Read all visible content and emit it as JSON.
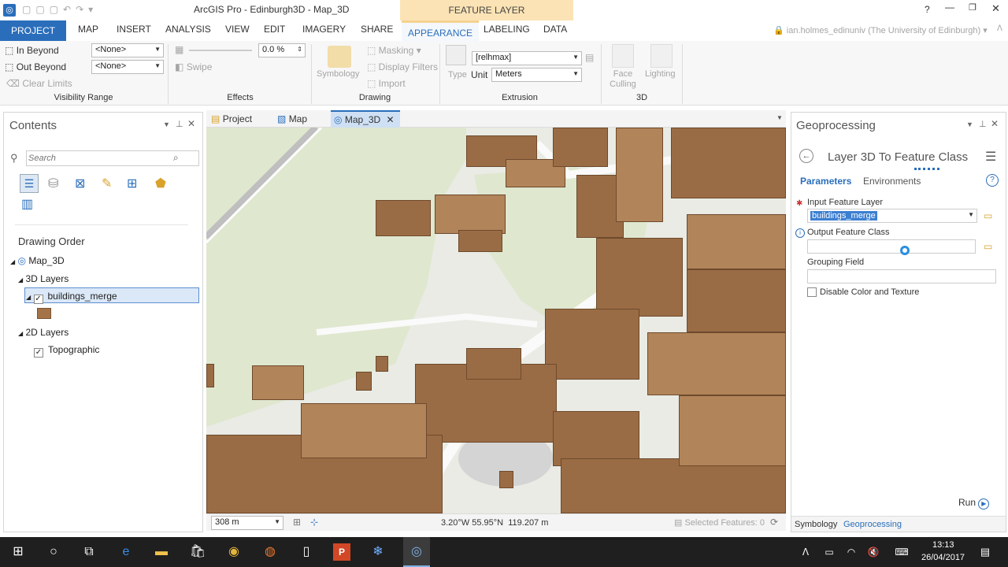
{
  "app": {
    "title": "ArcGIS Pro - Edinburgh3D - Map_3D",
    "context_tab": "FEATURE LAYER",
    "help": "?",
    "user": "ian.holmes_edinuniv (The University of Edinburgh)"
  },
  "tabs": [
    "PROJECT",
    "MAP",
    "INSERT",
    "ANALYSIS",
    "VIEW",
    "EDIT",
    "IMAGERY",
    "SHARE",
    "APPEARANCE",
    "LABELING",
    "DATA"
  ],
  "ribbon": {
    "visibility": {
      "in_beyond": "In Beyond",
      "out_beyond": "Out Beyond",
      "in_value": "<None>",
      "out_value": "<None>",
      "clear_limits": "Clear Limits",
      "label": "Visibility Range"
    },
    "effects": {
      "transparency": "0.0 %",
      "swipe": "Swipe",
      "label": "Effects"
    },
    "drawing": {
      "symbology": "Symbology",
      "masking": "Masking",
      "display_filters": "Display Filters",
      "import": "Import",
      "label": "Drawing"
    },
    "extrusion": {
      "type": "Type",
      "field": "[relhmax]",
      "unit_label": "Unit",
      "unit": "Meters",
      "label": "Extrusion"
    },
    "three_d": {
      "face_culling": "Face Culling",
      "lighting": "Lighting",
      "label": "3D"
    }
  },
  "contents": {
    "title": "Contents",
    "search_placeholder": "Search",
    "drawing_order": "Drawing Order",
    "map": "Map_3D",
    "group_3d": "3D Layers",
    "layer_3d": "buildings_merge",
    "group_2d": "2D Layers",
    "layer_2d": "Topographic"
  },
  "map_tabs": {
    "project": "Project",
    "map": "Map",
    "map3d": "Map_3D"
  },
  "status": {
    "scale": "308 m",
    "coords": "3.20°W 55.95°N  119.207 m",
    "selected": "Selected Features: 0"
  },
  "geoprocessing": {
    "title": "Geoprocessing",
    "tool": "Layer 3D To Feature Class",
    "tab_parameters": "Parameters",
    "tab_environments": "Environments",
    "input_label": "Input Feature Layer",
    "input_value": "buildings_merge",
    "output_label": "Output Feature Class",
    "grouping_label": "Grouping Field",
    "disable_label": "Disable Color and Texture",
    "run": "Run",
    "bottom_tab_symbology": "Symbology",
    "bottom_tab_geoprocessing": "Geoprocessing"
  },
  "taskbar": {
    "time": "13:13",
    "date": "26/04/2017"
  },
  "colors": {
    "accent": "#2a6ebb",
    "context": "#fbe3b5",
    "building": "#9a6c45"
  }
}
